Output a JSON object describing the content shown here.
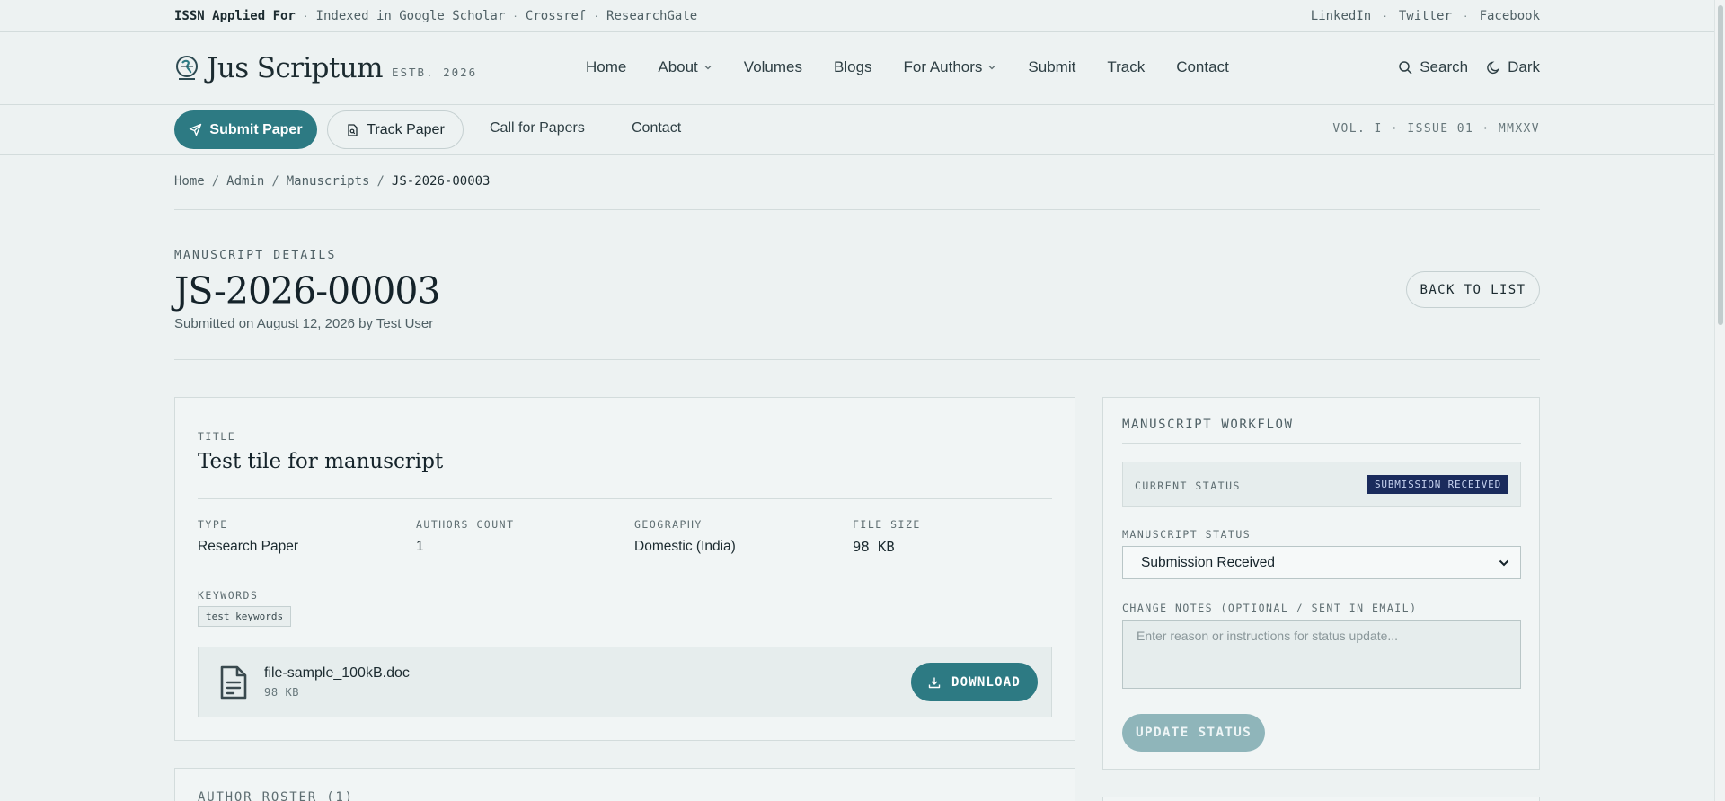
{
  "topbar": {
    "issn": "ISSN Applied For",
    "indexed": "Indexed in Google Scholar",
    "crossref": "Crossref",
    "researchgate": "ResearchGate",
    "social": [
      "LinkedIn",
      "Twitter",
      "Facebook"
    ]
  },
  "header": {
    "logo_text": "Jus Scriptum",
    "logo_est": "ESTB. 2026",
    "nav": [
      "Home",
      "About",
      "Volumes",
      "Blogs",
      "For Authors",
      "Submit",
      "Track",
      "Contact"
    ],
    "search_label": "Search",
    "theme_label": "Dark"
  },
  "actionbar": {
    "submit_label": "Submit Paper",
    "track_label": "Track Paper",
    "call_label": "Call for Papers",
    "contact_label": "Contact",
    "volume_info": "VOL. I · ISSUE 01 · MMXXV"
  },
  "breadcrumb": [
    "Home",
    "Admin",
    "Manuscripts",
    "JS-2026-00003"
  ],
  "page": {
    "eyebrow": "MANUSCRIPT DETAILS",
    "title": "JS-2026-00003",
    "subtitle": "Submitted on August 12, 2026 by Test User",
    "back_label": "BACK TO LIST"
  },
  "manuscript": {
    "title_label": "TITLE",
    "title": "Test tile for manuscript",
    "meta": [
      {
        "label": "TYPE",
        "value": "Research Paper"
      },
      {
        "label": "AUTHORS COUNT",
        "value": "1"
      },
      {
        "label": "GEOGRAPHY",
        "value": "Domestic (India)"
      },
      {
        "label": "FILE SIZE",
        "value": "98 KB"
      }
    ],
    "keywords_label": "KEYWORDS",
    "keywords": [
      "test keywords"
    ],
    "file": {
      "name": "file-sample_100kB.doc",
      "size": "98 KB",
      "download_label": "DOWNLOAD"
    }
  },
  "author_roster": {
    "label": "AUTHOR ROSTER (1)"
  },
  "workflow": {
    "title": "MANUSCRIPT WORKFLOW",
    "current_status_label": "CURRENT STATUS",
    "current_status": "SUBMISSION RECEIVED",
    "status_label": "MANUSCRIPT STATUS",
    "selected_status": "Submission Received",
    "notes_label": "CHANGE NOTES (OPTIONAL / SENT IN EMAIL)",
    "notes_placeholder": "Enter reason or instructions for status update...",
    "update_label": "UPDATE STATUS"
  },
  "colors": {
    "accent": "#2d7a83",
    "badge_bg": "#1a2b5c",
    "update_disabled": "#8fb5ba",
    "page_bg": "#edf2f2"
  }
}
